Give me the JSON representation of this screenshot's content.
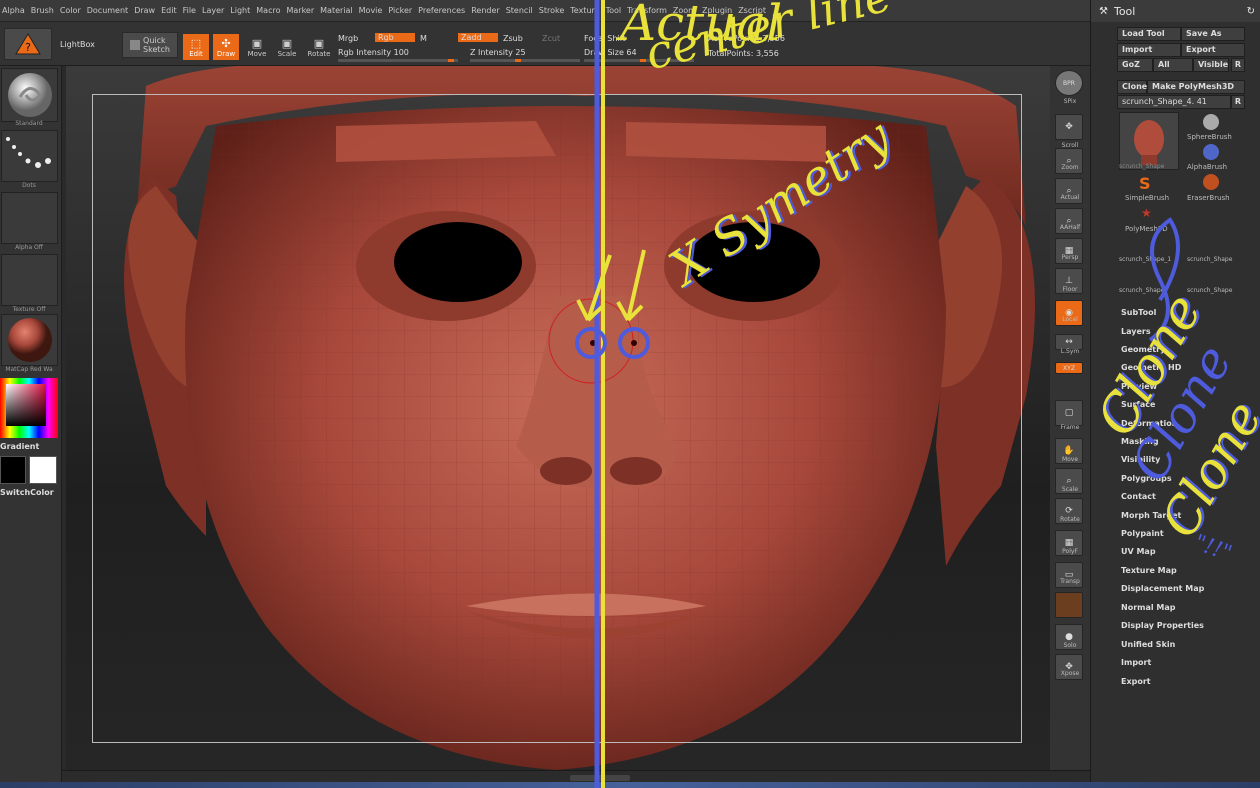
{
  "menu": [
    "Alpha",
    "Brush",
    "Color",
    "Document",
    "Draw",
    "Edit",
    "File",
    "Layer",
    "Light",
    "Macro",
    "Marker",
    "Material",
    "Movie",
    "Picker",
    "Preferences",
    "Render",
    "Stencil",
    "Stroke",
    "Texture",
    "Tool",
    "Transform",
    "Zoom",
    "Zplugin",
    "Zscript"
  ],
  "shelf": {
    "lightbox": "LightBox",
    "quick_sketch_1": "Quick",
    "quick_sketch_2": "Sketch",
    "edit": "Edit",
    "draw": "Draw",
    "move": "Move",
    "scale": "Scale",
    "rotate": "Rotate",
    "mrgb": "Mrgb",
    "rgb": "Rgb",
    "m": "M",
    "zadd": "Zadd",
    "zsub": "Zsub",
    "zcut": "Zcut",
    "rgb_intensity": "Rgb Intensity 100",
    "z_intensity": "Z Intensity 25",
    "focal_shift": "Focal Shift",
    "draw_size": "Draw Size 64",
    "active_points": "ActivePoints: 3,556",
    "total_points": "TotalPoints: 3,556"
  },
  "left": {
    "standard": "Standard",
    "dots": "Dots",
    "alpha_off": "Alpha  Off",
    "texture_off": "Texture  Off",
    "matcap": "MatCap  Red  Wa",
    "gradient": "Gradient",
    "switchcolor": "SwitchColor"
  },
  "right_toolbar": [
    "BPR",
    "SPix",
    "Scroll",
    "Zoom",
    "Actual",
    "AAHalf",
    "Persp",
    "Floor",
    "Local",
    "L.Sym",
    "XYZ",
    "Frame",
    "Move",
    "Scale",
    "Rotate",
    "PolyF",
    "Transp",
    "Ghost",
    "Solo",
    "Xpose"
  ],
  "tool_panel": {
    "title": "Tool",
    "load_tool": "Load Tool",
    "save_as": "Save As",
    "import": "Import",
    "export": "Export",
    "goz": "GoZ",
    "all": "All",
    "visible": "Visible",
    "r": "R",
    "clone": "Clone",
    "make_polymesh": "Make PolyMesh3D",
    "current_tool": "scrunch_Shape_4. 41",
    "r2": "R",
    "thumbs": [
      "scrunch_Shape",
      "SphereBrush",
      "AlphaBrush",
      "SimpleBrush",
      "EraserBrush",
      "PolyMesh3D",
      "scrunch_Shape_1",
      "scrunch_Shape",
      "scrunch_Shape",
      "scrunch_Shape"
    ],
    "subpalettes": [
      "SubTool",
      "Layers",
      "Geometry",
      "Geometry HD",
      "Preview",
      "Surface",
      "Deformation",
      "Masking",
      "Visibility",
      "Polygroups",
      "Contact",
      "Morph Target",
      "Polypaint",
      "UV Map",
      "Texture Map",
      "Displacement Map",
      "Normal Map",
      "Display Properties",
      "Unified Skin",
      "Import",
      "Export"
    ]
  },
  "annotations": {
    "line1": "Actual",
    "line2": "center line",
    "symmetry": "X Symetry",
    "clone1": "Clone",
    "clone2": "Clone",
    "clone3": "Clone",
    "ditto": "\"!!\""
  },
  "colors": {
    "accent": "#ea6a18",
    "mesh": "#a6473a",
    "yellow_ink": "#e8e23a",
    "blue_ink": "#4d5bdc"
  }
}
